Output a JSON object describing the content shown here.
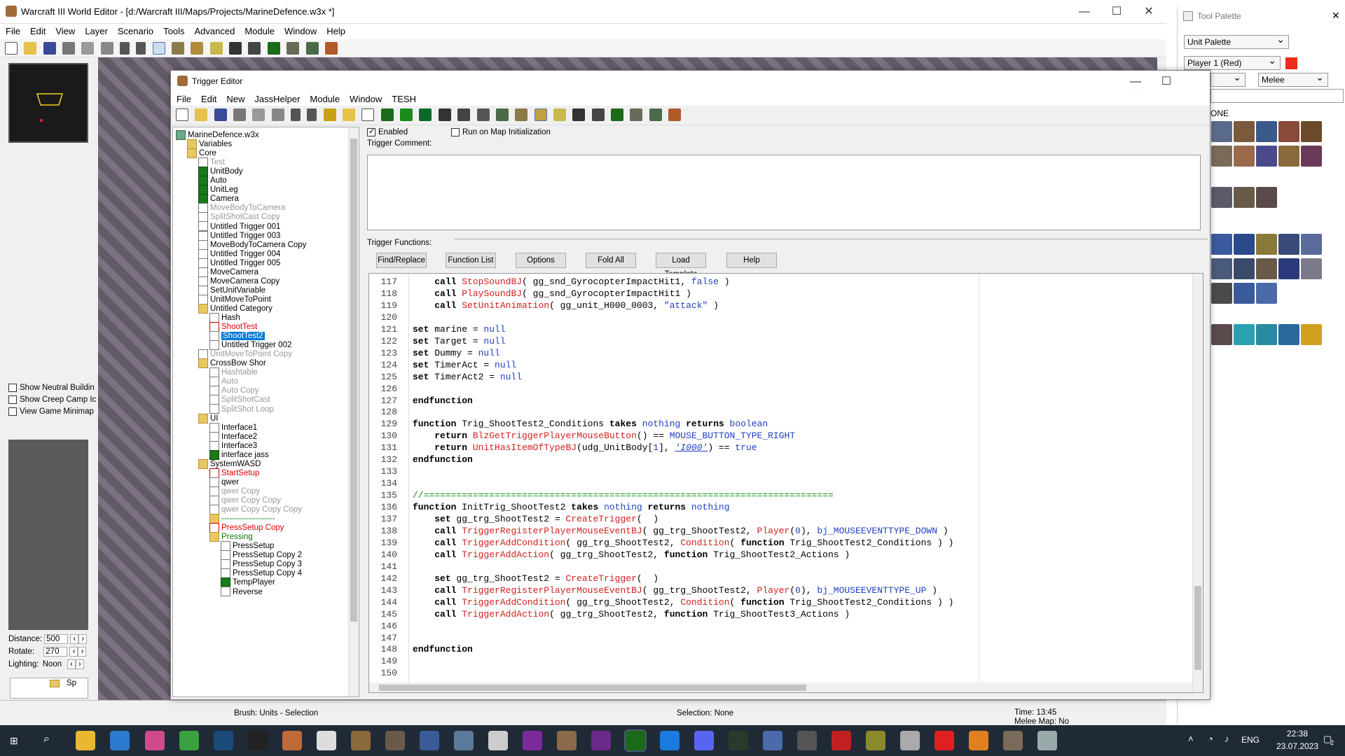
{
  "main": {
    "title": "Warcraft III World Editor - [d:/Warcraft III/Maps/Projects/MarineDefence.w3x *]",
    "menu": [
      "File",
      "Edit",
      "View",
      "Layer",
      "Scenario",
      "Tools",
      "Advanced",
      "Module",
      "Window",
      "Help"
    ],
    "min": "—",
    "max": "☐",
    "close": "✕"
  },
  "left": {
    "show_neutral": "Show Neutral Buildin",
    "show_creep": "Show Creep Camp Ic",
    "view_minimap": "View Game Minimap",
    "distance_label": "Distance:",
    "distance_value": "500",
    "rotate_label": "Rotate:",
    "rotate_value": "270",
    "lighting_label": "Lighting:",
    "lighting_value": "Noon",
    "bottom_tab": "Sp"
  },
  "status": {
    "brush": "Brush: Units - Selection",
    "selection": "Selection: None",
    "time": "Time: 13:45",
    "melee": "Melee Map: No"
  },
  "palette": {
    "title": "Tool Palette",
    "close": "✕",
    "type_select": "Unit Palette",
    "player_select": "Player 1 (Red)",
    "player_color": "#ee2a1a",
    "race_select": "Melee",
    "section_label": "ONE"
  },
  "trigger_editor": {
    "title": "Trigger Editor",
    "menu": [
      "File",
      "Edit",
      "New",
      "JassHelper",
      "Module",
      "Window",
      "TESH"
    ],
    "enabled_label": "Enabled",
    "run_on_init_label": "Run on Map Initialization",
    "comment_label": "Trigger Comment:",
    "functions_label": "Trigger Functions:",
    "buttons": [
      "Find/Replace",
      "Function List",
      "Options",
      "Fold All",
      "Load Template",
      "Help"
    ],
    "tree": [
      {
        "label": "MarineDefence.w3x",
        "level": 0,
        "icon": "map",
        "style": ""
      },
      {
        "label": "Variables",
        "level": 1,
        "icon": "folder",
        "style": ""
      },
      {
        "label": "Core",
        "level": 1,
        "icon": "folder",
        "style": ""
      },
      {
        "label": "Test",
        "level": 2,
        "icon": "doc",
        "style": "dis"
      },
      {
        "label": "UnitBody",
        "level": 2,
        "icon": "trig",
        "style": ""
      },
      {
        "label": "Auto",
        "level": 2,
        "icon": "trig",
        "style": ""
      },
      {
        "label": "UnitLeg",
        "level": 2,
        "icon": "trig",
        "style": ""
      },
      {
        "label": "Camera",
        "level": 2,
        "icon": "trig",
        "style": ""
      },
      {
        "label": "MoveBodyToCamera",
        "level": 2,
        "icon": "doc",
        "style": "dis"
      },
      {
        "label": "SplitShotCast Copy",
        "level": 2,
        "icon": "doc",
        "style": "dis"
      },
      {
        "label": "Untitled Trigger 001",
        "level": 2,
        "icon": "doc",
        "style": ""
      },
      {
        "label": "Untitled Trigger 003",
        "level": 2,
        "icon": "doc",
        "style": ""
      },
      {
        "label": "MoveBodyToCamera Copy",
        "level": 2,
        "icon": "doc",
        "style": ""
      },
      {
        "label": "Untitled Trigger 004",
        "level": 2,
        "icon": "doc",
        "style": ""
      },
      {
        "label": "Untitled Trigger 005",
        "level": 2,
        "icon": "doc",
        "style": ""
      },
      {
        "label": "MoveCamera",
        "level": 2,
        "icon": "doc",
        "style": ""
      },
      {
        "label": "MoveCamera Copy",
        "level": 2,
        "icon": "doc",
        "style": ""
      },
      {
        "label": "SetUnitVariable",
        "level": 2,
        "icon": "doc",
        "style": ""
      },
      {
        "label": "UnitMoveToPoint",
        "level": 2,
        "icon": "doc",
        "style": ""
      },
      {
        "label": "Untitled Category",
        "level": 2,
        "icon": "folder",
        "style": ""
      },
      {
        "label": "Hash",
        "level": 3,
        "icon": "doc",
        "style": ""
      },
      {
        "label": "ShootTest",
        "level": 3,
        "icon": "trigx",
        "style": "red"
      },
      {
        "label": "ShootTest2",
        "level": 3,
        "icon": "doc",
        "style": "selnode"
      },
      {
        "label": "Untitled Trigger 002",
        "level": 3,
        "icon": "doc",
        "style": ""
      },
      {
        "label": "UnitMoveToPoint Copy",
        "level": 2,
        "icon": "doc",
        "style": "dis"
      },
      {
        "label": "CrossBow Shor",
        "level": 2,
        "icon": "folder",
        "style": ""
      },
      {
        "label": "Hashtable",
        "level": 3,
        "icon": "doc",
        "style": "dis"
      },
      {
        "label": "Auto",
        "level": 3,
        "icon": "doc",
        "style": "dis"
      },
      {
        "label": "Auto Copy",
        "level": 3,
        "icon": "doc",
        "style": "dis"
      },
      {
        "label": "SplitShotCast",
        "level": 3,
        "icon": "doc",
        "style": "dis"
      },
      {
        "label": "SplitShot Loop",
        "level": 3,
        "icon": "doc",
        "style": "dis"
      },
      {
        "label": "UI",
        "level": 2,
        "icon": "folder",
        "style": ""
      },
      {
        "label": "Interface1",
        "level": 3,
        "icon": "doc",
        "style": ""
      },
      {
        "label": "Interface2",
        "level": 3,
        "icon": "doc",
        "style": ""
      },
      {
        "label": "Interface3",
        "level": 3,
        "icon": "doc",
        "style": ""
      },
      {
        "label": "interface jass",
        "level": 3,
        "icon": "trig",
        "style": ""
      },
      {
        "label": "SystemWASD",
        "level": 2,
        "icon": "folder",
        "style": ""
      },
      {
        "label": "StartSetup",
        "level": 3,
        "icon": "trigx",
        "style": "red"
      },
      {
        "label": "qwer",
        "level": 3,
        "icon": "doc",
        "style": ""
      },
      {
        "label": "qwer Copy",
        "level": 3,
        "icon": "doc",
        "style": "dis"
      },
      {
        "label": "qwer Copy Copy",
        "level": 3,
        "icon": "doc",
        "style": "dis"
      },
      {
        "label": "qwer Copy Copy Copy",
        "level": 3,
        "icon": "doc",
        "style": "dis"
      },
      {
        "label": "--------------------",
        "level": 3,
        "icon": "folder",
        "style": "green"
      },
      {
        "label": "PressSetup Copy",
        "level": 3,
        "icon": "trigx",
        "style": "red"
      },
      {
        "label": "Pressing",
        "level": 3,
        "icon": "folder",
        "style": "green"
      },
      {
        "label": "PressSetup",
        "level": 4,
        "icon": "doc",
        "style": ""
      },
      {
        "label": "PressSetup Copy 2",
        "level": 4,
        "icon": "doc",
        "style": ""
      },
      {
        "label": "PressSetup Copy 3",
        "level": 4,
        "icon": "doc",
        "style": ""
      },
      {
        "label": "PressSetup Copy 4",
        "level": 4,
        "icon": "doc",
        "style": ""
      },
      {
        "label": "TempPlayer",
        "level": 4,
        "icon": "trig",
        "style": ""
      },
      {
        "label": "Reverse",
        "level": 4,
        "icon": "doc",
        "style": ""
      }
    ],
    "code": [
      {
        "n": "117",
        "h": "    <span class='kw'>call</span> <span class='fn'>StopSoundBJ</span>( gg_snd_GyrocopterImpactHit1, <span class='cn'>false</span> )"
      },
      {
        "n": "118",
        "h": "    <span class='kw'>call</span> <span class='fn'>PlaySoundBJ</span>( gg_snd_GyrocopterImpactHit1 )"
      },
      {
        "n": "119",
        "h": "    <span class='kw'>call</span> <span class='fn'>SetUnitAnimation</span>( gg_unit_H000_0003, <span class='nu'>\"attack\"</span> )"
      },
      {
        "n": "120",
        "h": ""
      },
      {
        "n": "121",
        "h": "<span class='kw'>set</span> marine = <span class='cn'>null</span>"
      },
      {
        "n": "122",
        "h": "<span class='kw'>set</span> Target = <span class='cn'>null</span>"
      },
      {
        "n": "123",
        "h": "<span class='kw'>set</span> Dummy = <span class='cn'>null</span>"
      },
      {
        "n": "124",
        "h": "<span class='kw'>set</span> TimerAct = <span class='cn'>null</span>"
      },
      {
        "n": "125",
        "h": "<span class='kw'>set</span> TimerAct2 = <span class='cn'>null</span>"
      },
      {
        "n": "126",
        "h": ""
      },
      {
        "n": "127",
        "h": "<span class='kw'>endfunction</span>"
      },
      {
        "n": "128",
        "h": ""
      },
      {
        "n": "129",
        "h": "<span class='kw'>function</span> Trig_ShootTest2_Conditions <span class='kw'>takes</span> <span class='ty'>nothing</span> <span class='kw'>returns</span> <span class='ty'>boolean</span>"
      },
      {
        "n": "130",
        "h": "    <span class='kw'>return</span> <span class='fn'>BlzGetTriggerPlayerMouseButton</span>() == <span class='cn'>MOUSE_BUTTON_TYPE_RIGHT</span>"
      },
      {
        "n": "131",
        "h": "    <span class='kw'>return</span> <span class='fn'>UnitHasItemOfTypeBJ</span>(udg_UnitBody[<span class='nu'>1</span>], <span class='st'>'I000'</span>) == <span class='cn'>true</span>"
      },
      {
        "n": "132",
        "h": "<span class='kw'>endfunction</span>"
      },
      {
        "n": "133",
        "h": ""
      },
      {
        "n": "134",
        "h": ""
      },
      {
        "n": "135",
        "h": "<span class='cm'>//===========================================================================</span>"
      },
      {
        "n": "136",
        "h": "<span class='kw'>function</span> InitTrig_ShootTest2 <span class='kw'>takes</span> <span class='ty'>nothing</span> <span class='kw'>returns</span> <span class='ty'>nothing</span>"
      },
      {
        "n": "137",
        "h": "    <span class='kw'>set</span> gg_trg_ShootTest2 = <span class='fn'>CreateTrigger</span>(  )"
      },
      {
        "n": "138",
        "h": "    <span class='kw'>call</span> <span class='fn'>TriggerRegisterPlayerMouseEventBJ</span>( gg_trg_ShootTest2, <span class='fn'>Player</span>(<span class='nu'>0</span>), <span class='cn'>bj_MOUSEEVENTTYPE_DOWN</span> )"
      },
      {
        "n": "139",
        "h": "    <span class='kw'>call</span> <span class='fn'>TriggerAddCondition</span>( gg_trg_ShootTest2, <span class='fn'>Condition</span>( <span class='kw'>function</span> Trig_ShootTest2_Conditions ) )"
      },
      {
        "n": "140",
        "h": "    <span class='kw'>call</span> <span class='fn'>TriggerAddAction</span>( gg_trg_ShootTest2, <span class='kw'>function</span> Trig_ShootTest2_Actions )"
      },
      {
        "n": "141",
        "h": ""
      },
      {
        "n": "142",
        "h": "    <span class='kw'>set</span> gg_trg_ShootTest2 = <span class='fn'>CreateTrigger</span>(  )"
      },
      {
        "n": "143",
        "h": "    <span class='kw'>call</span> <span class='fn'>TriggerRegisterPlayerMouseEventBJ</span>( gg_trg_ShootTest2, <span class='fn'>Player</span>(<span class='nu'>0</span>), <span class='cn'>bj_MOUSEEVENTTYPE_UP</span> )"
      },
      {
        "n": "144",
        "h": "    <span class='kw'>call</span> <span class='fn'>TriggerAddCondition</span>( gg_trg_ShootTest2, <span class='fn'>Condition</span>( <span class='kw'>function</span> Trig_ShootTest2_Conditions ) )"
      },
      {
        "n": "145",
        "h": "    <span class='kw'>call</span> <span class='fn'>TriggerAddAction</span>( gg_trg_ShootTest2, <span class='kw'>function</span> Trig_ShootTest3_Actions )"
      },
      {
        "n": "146",
        "h": ""
      },
      {
        "n": "147",
        "h": ""
      },
      {
        "n": "148",
        "h": "<span class='kw'>endfunction</span>"
      },
      {
        "n": "149",
        "h": ""
      },
      {
        "n": "150",
        "h": ""
      }
    ]
  },
  "taskbar": {
    "time": "22:38",
    "date": "23.07.2023",
    "lang": "ENG",
    "notif_count": "2"
  }
}
